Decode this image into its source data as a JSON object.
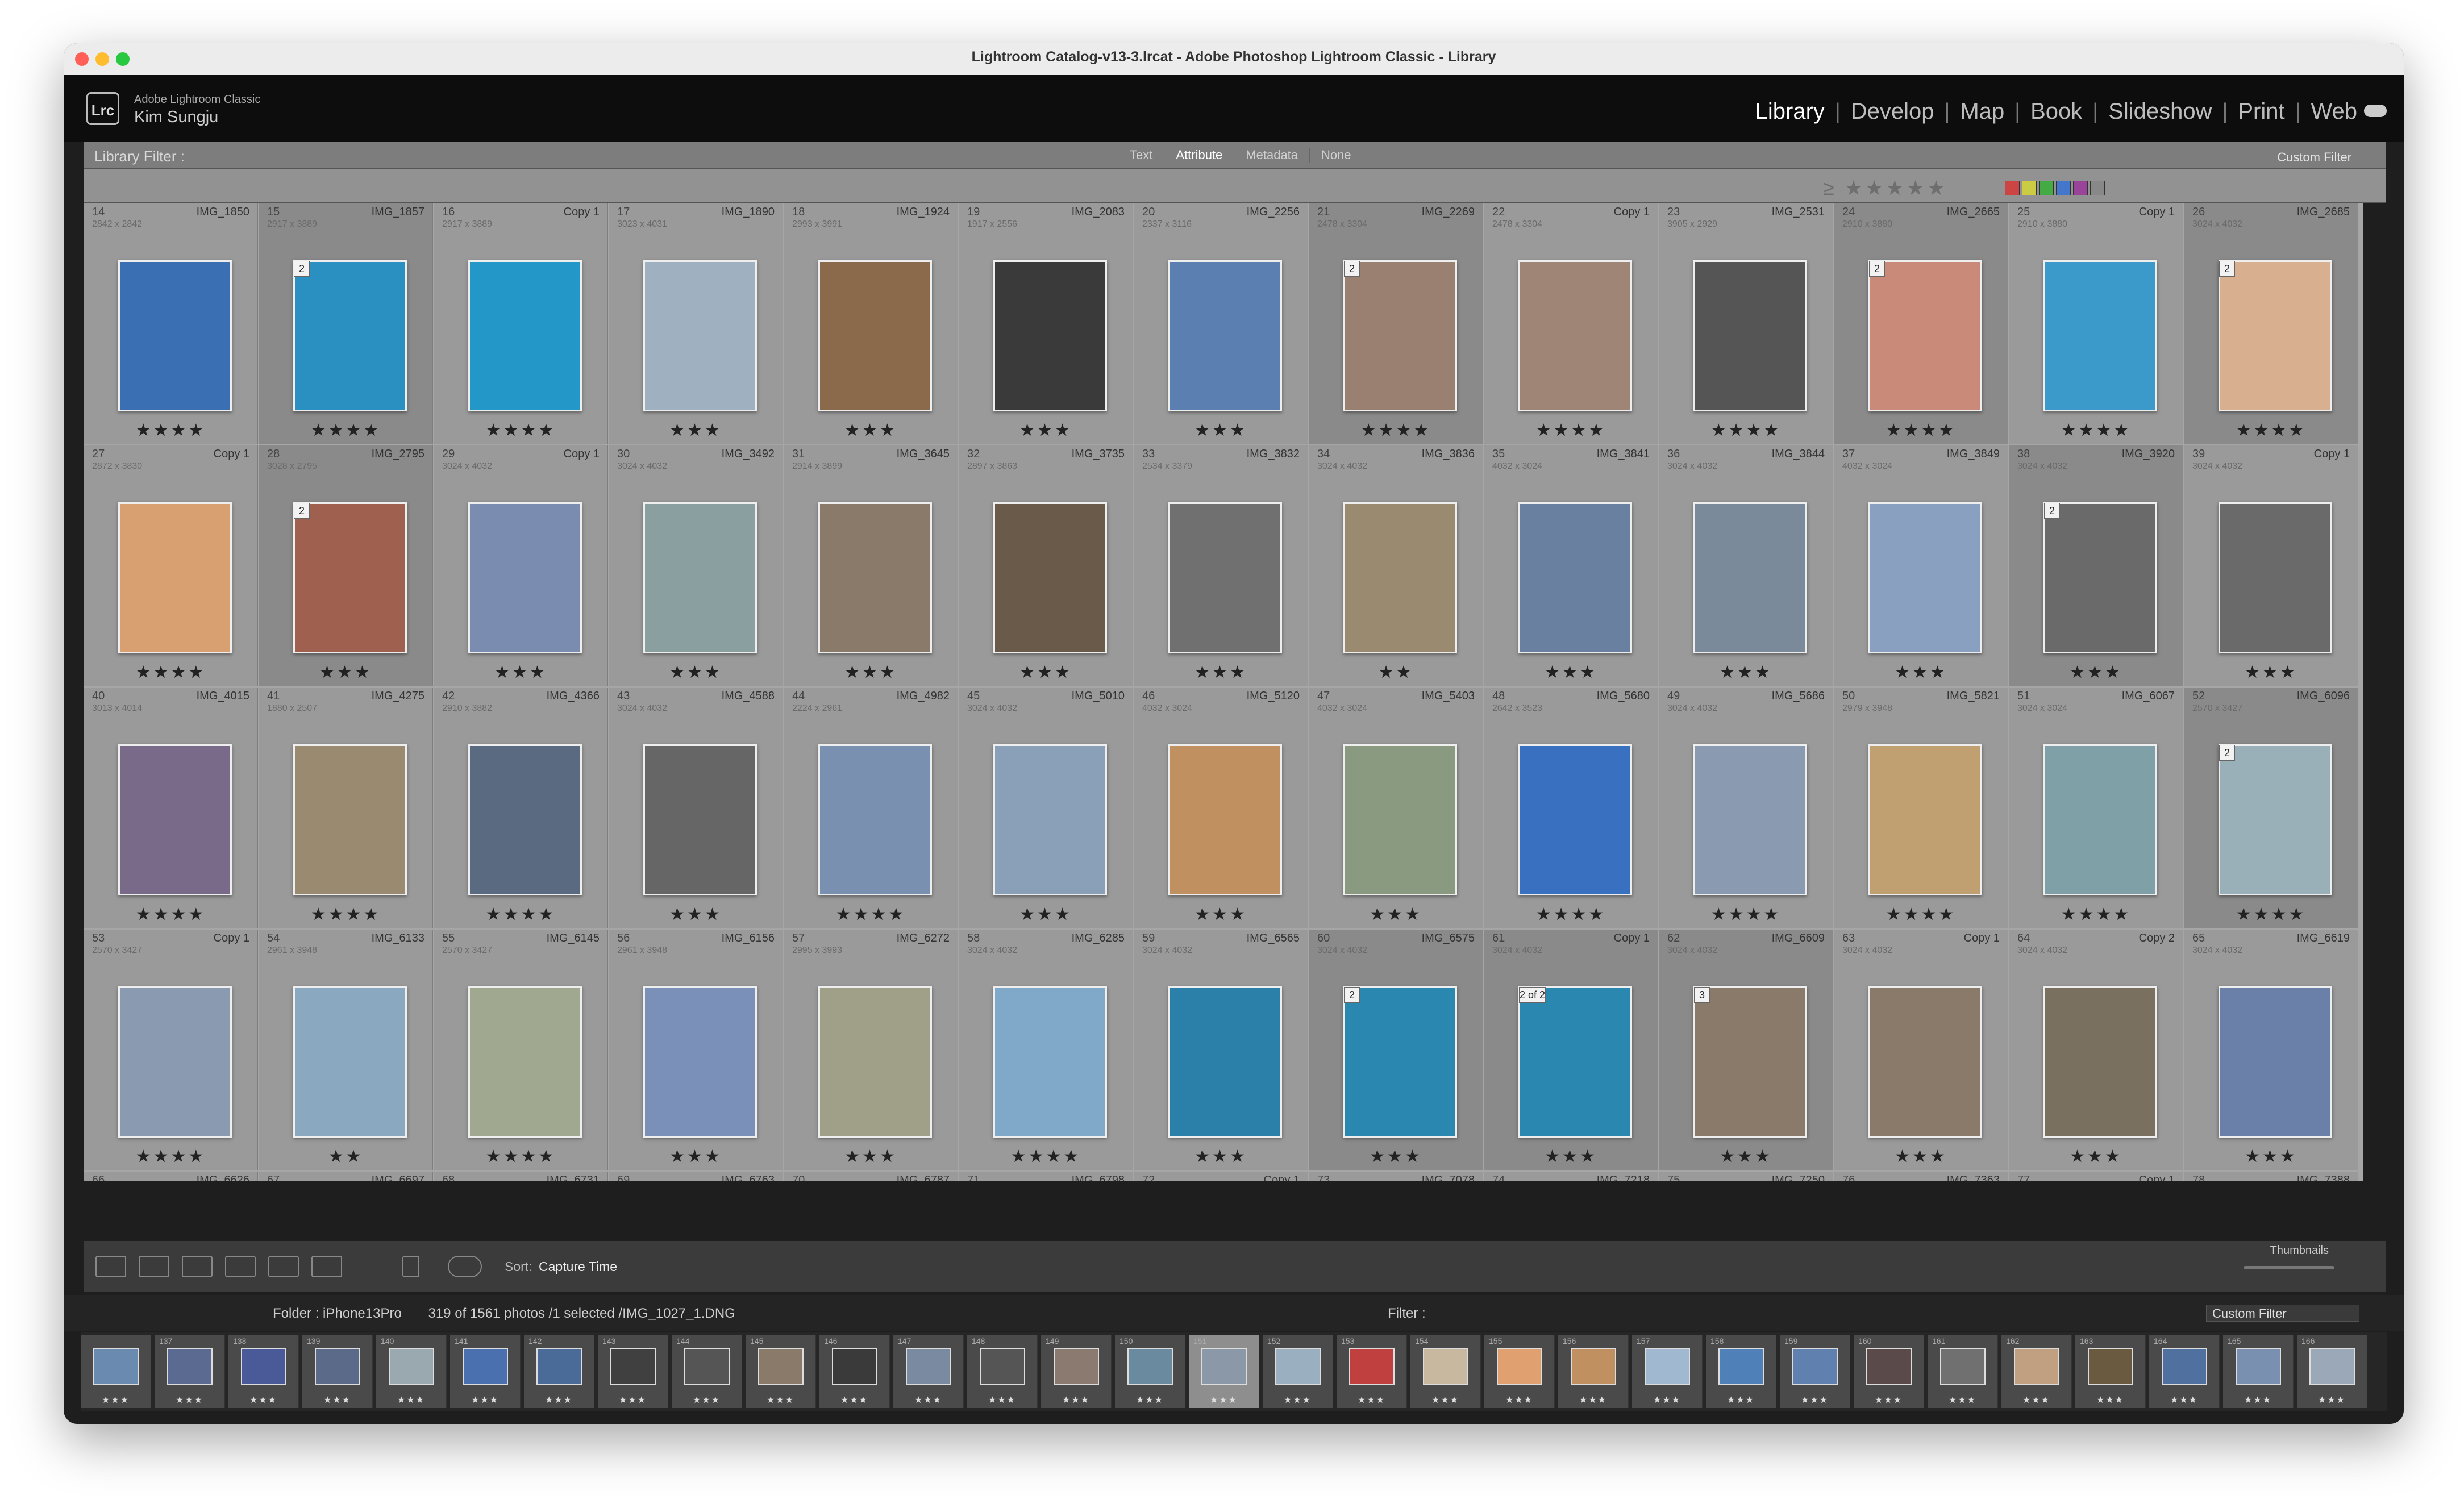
{
  "window": {
    "title": "Lightroom Catalog-v13-3.lrcat - Adobe Photoshop Lightroom Classic - Library"
  },
  "identity": {
    "app": "Adobe Lightroom Classic",
    "user": "Kim Sungju",
    "logo": "Lrc"
  },
  "modules": [
    {
      "label": "Library",
      "active": true
    },
    {
      "label": "Develop"
    },
    {
      "label": "Map"
    },
    {
      "label": "Book"
    },
    {
      "label": "Slideshow"
    },
    {
      "label": "Print"
    },
    {
      "label": "Web"
    }
  ],
  "filter_bar": {
    "title": "Library Filter :",
    "tabs": [
      "Text",
      "Attribute",
      "Metadata",
      "None"
    ],
    "active_tab": "Attribute",
    "preset": "Custom Filter"
  },
  "colors": {
    "label_swatches": [
      "#c44",
      "#cc4",
      "#4a4",
      "#47c",
      "#949",
      "#888"
    ]
  },
  "grid": {
    "rows": [
      {
        "top_stars": "★★★★",
        "cells": [
          {
            "n": "14",
            "f": "IMG_1850",
            "d": "2842 x 2842",
            "c": "#3a6fb4",
            "stars": "★★★★"
          },
          {
            "n": "15",
            "f": "IMG_1857",
            "d": "2917 x 3889",
            "c": "#2a8fc1",
            "badge": "2",
            "stars": "★★★★"
          },
          {
            "n": "16",
            "f": "Copy 1",
            "d": "2917 x 3889",
            "c": "#2398c8",
            "stars": "★★★★"
          },
          {
            "n": "17",
            "f": "IMG_1890",
            "d": "3023 x 4031",
            "c": "#9fb0c0",
            "stars": "★★★"
          },
          {
            "n": "18",
            "f": "IMG_1924",
            "d": "2993 x 3991",
            "c": "#8a6a4a",
            "stars": "★★★"
          },
          {
            "n": "19",
            "f": "IMG_2083",
            "d": "1917 x 2556",
            "c": "#3a3a3a",
            "stars": "★★★"
          },
          {
            "n": "20",
            "f": "IMG_2256",
            "d": "2337 x 3116",
            "c": "#5a7fb0",
            "stars": "★★★"
          },
          {
            "n": "21",
            "f": "IMG_2269",
            "d": "2478 x 3304",
            "c": "#9a8070",
            "badge": "2",
            "stars": "★★★★"
          },
          {
            "n": "22",
            "f": "Copy 1",
            "d": "2478 x 3304",
            "c": "#9e8575",
            "stars": "★★★★"
          },
          {
            "n": "23",
            "f": "IMG_2531",
            "d": "3905 x 2929",
            "c": "#555555",
            "stars": "★★★★"
          },
          {
            "n": "24",
            "f": "IMG_2665",
            "d": "2910 x 3880",
            "c": "#c98a7a",
            "badge": "2",
            "stars": "★★★★"
          },
          {
            "n": "25",
            "f": "Copy 1",
            "d": "2910 x 3880",
            "c": "#3b9ac9",
            "stars": "★★★★"
          },
          {
            "n": "26",
            "f": "IMG_2685",
            "d": "3024 x 4032",
            "c": "#d8b090",
            "badge": "2",
            "stars": "★★★★"
          }
        ]
      },
      {
        "top_stars": "★★★★",
        "cells": [
          {
            "n": "27",
            "f": "Copy 1",
            "d": "2872 x 3830",
            "c": "#d8a070",
            "stars": "★★★★"
          },
          {
            "n": "28",
            "f": "IMG_2795",
            "d": "3028 x 2795",
            "c": "#a06050",
            "badge": "2",
            "stars": "★★★"
          },
          {
            "n": "29",
            "f": "Copy 1",
            "d": "3024 x 4032",
            "c": "#7a8cb0",
            "stars": "★★★"
          },
          {
            "n": "30",
            "f": "IMG_3492",
            "d": "3024 x 4032",
            "c": "#8aa0a0",
            "stars": "★★★"
          },
          {
            "n": "31",
            "f": "IMG_3645",
            "d": "2914 x 3899",
            "c": "#8a7a6a",
            "stars": "★★★"
          },
          {
            "n": "32",
            "f": "IMG_3735",
            "d": "2897 x 3863",
            "c": "#6a5a4a",
            "stars": "★★★"
          },
          {
            "n": "33",
            "f": "IMG_3832",
            "d": "2534 x 3379",
            "c": "#707070",
            "stars": "★★★"
          },
          {
            "n": "34",
            "f": "IMG_3836",
            "d": "3024 x 4032",
            "c": "#9a8a70",
            "stars": "★★"
          },
          {
            "n": "35",
            "f": "IMG_3841",
            "d": "4032 x 3024",
            "c": "#6a80a0",
            "stars": "★★★"
          },
          {
            "n": "36",
            "f": "IMG_3844",
            "d": "3024 x 4032",
            "c": "#7a8a9a",
            "stars": "★★★"
          },
          {
            "n": "37",
            "f": "IMG_3849",
            "d": "4032 x 3024",
            "c": "#8aa0c0",
            "stars": "★★★"
          },
          {
            "n": "38",
            "f": "IMG_3920",
            "d": "3024 x 4032",
            "c": "#6a6a6a",
            "badge": "2",
            "stars": "★★★"
          },
          {
            "n": "39",
            "f": "Copy 1",
            "d": "3024 x 4032",
            "c": "#6a6a6a",
            "stars": "★★★"
          }
        ]
      },
      {
        "top_stars": "★★★★",
        "cells": [
          {
            "n": "40",
            "f": "IMG_4015",
            "d": "3013 x 4014",
            "c": "#7a6a8a",
            "stars": "★★★★"
          },
          {
            "n": "41",
            "f": "IMG_4275",
            "d": "1880 x 2507",
            "c": "#9a8a70",
            "stars": "★★★★"
          },
          {
            "n": "42",
            "f": "IMG_4366",
            "d": "2910 x 3882",
            "c": "#5a6a80",
            "stars": "★★★★"
          },
          {
            "n": "43",
            "f": "IMG_4588",
            "d": "3024 x 4032",
            "c": "#666666",
            "stars": "★★★"
          },
          {
            "n": "44",
            "f": "IMG_4982",
            "d": "2224 x 2961",
            "c": "#7a90b0",
            "stars": "★★★★"
          },
          {
            "n": "45",
            "f": "IMG_5010",
            "d": "3024 x 4032",
            "c": "#8aa0b8",
            "stars": "★★★"
          },
          {
            "n": "46",
            "f": "IMG_5120",
            "d": "4032 x 3024",
            "c": "#c09060",
            "stars": "★★★"
          },
          {
            "n": "47",
            "f": "IMG_5403",
            "d": "4032 x 3024",
            "c": "#8a9a80",
            "stars": "★★★"
          },
          {
            "n": "48",
            "f": "IMG_5680",
            "d": "2642 x 3523",
            "c": "#3a70c0",
            "stars": "★★★★"
          },
          {
            "n": "49",
            "f": "IMG_5686",
            "d": "3024 x 4032",
            "c": "#8a9ab0",
            "stars": "★★★★"
          },
          {
            "n": "50",
            "f": "IMG_5821",
            "d": "2979 x 3948",
            "c": "#c0a070",
            "stars": "★★★★"
          },
          {
            "n": "51",
            "f": "IMG_6067",
            "d": "3024 x 3024",
            "c": "#80a0a8",
            "stars": "★★★★"
          },
          {
            "n": "52",
            "f": "IMG_6096",
            "d": "2570 x 3427",
            "c": "#9ab0b8",
            "badge": "2",
            "stars": "★★★★"
          }
        ]
      },
      {
        "top_stars": "★★★★",
        "cells": [
          {
            "n": "53",
            "f": "Copy 1",
            "d": "2570 x 3427",
            "c": "#8a9ab0",
            "stars": "★★★★"
          },
          {
            "n": "54",
            "f": "IMG_6133",
            "d": "2961 x 3948",
            "c": "#8aa8c0",
            "stars": "★★"
          },
          {
            "n": "55",
            "f": "IMG_6145",
            "d": "2570 x 3427",
            "c": "#a0a890",
            "stars": "★★★★"
          },
          {
            "n": "56",
            "f": "IMG_6156",
            "d": "2961 x 3948",
            "c": "#7a90b8",
            "stars": "★★★"
          },
          {
            "n": "57",
            "f": "IMG_6272",
            "d": "2995 x 3993",
            "c": "#a0a088",
            "stars": "★★★"
          },
          {
            "n": "58",
            "f": "IMG_6285",
            "d": "3024 x 4032",
            "c": "#80a8c8",
            "stars": "★★★★"
          },
          {
            "n": "59",
            "f": "IMG_6565",
            "d": "3024 x 4032",
            "c": "#2a80a8",
            "stars": "★★★"
          },
          {
            "n": "60",
            "f": "IMG_6575",
            "d": "3024 x 4032",
            "c": "#2a88b0",
            "badge": "2",
            "stars": "★★★"
          },
          {
            "n": "61",
            "f": "Copy 1",
            "d": "3024 x 4032",
            "c": "#2a88b0",
            "badge": "2 of 2",
            "stars": "★★★"
          },
          {
            "n": "62",
            "f": "IMG_6609",
            "d": "3024 x 4032",
            "c": "#8a7a6a",
            "badge": "3",
            "stars": "★★★"
          },
          {
            "n": "63",
            "f": "Copy 1",
            "d": "3024 x 4032",
            "c": "#8a7a6a",
            "stars": "★★★"
          },
          {
            "n": "64",
            "f": "Copy 2",
            "d": "3024 x 4032",
            "c": "#7a7060",
            "stars": "★★★"
          },
          {
            "n": "65",
            "f": "IMG_6619",
            "d": "3024 x 4032",
            "c": "#6a80a8",
            "stars": "★★★"
          }
        ]
      }
    ],
    "bottom_row": [
      {
        "n": "66",
        "f": "IMG_6626"
      },
      {
        "n": "67",
        "f": "IMG_6697"
      },
      {
        "n": "68",
        "f": "IMG_6731"
      },
      {
        "n": "69",
        "f": "IMG_6763"
      },
      {
        "n": "70",
        "f": "IMG_6787"
      },
      {
        "n": "71",
        "f": "IMG_6798"
      },
      {
        "n": "72",
        "f": "Copy 1"
      },
      {
        "n": "73",
        "f": "IMG_7078"
      },
      {
        "n": "74",
        "f": "IMG_7218"
      },
      {
        "n": "75",
        "f": "IMG_7250"
      },
      {
        "n": "76",
        "f": "IMG_7363"
      },
      {
        "n": "77",
        "f": "Copy 1"
      },
      {
        "n": "78",
        "f": "IMG_7388"
      }
    ]
  },
  "toolbar": {
    "sort_label": "Sort:",
    "sort_value": "Capture Time",
    "thumbnails_label": "Thumbnails",
    "thumbnail_size": 0.5
  },
  "filmstrip_header": {
    "folder": "Folder : iPhone13Pro",
    "count": "319 of 1561 photos /1 selected /IMG_1027_1.DNG",
    "filter_label": "Filter :",
    "preset": "Custom Filter"
  },
  "filmstrip": [
    {
      "n": "",
      "c": "#6a8ab0"
    },
    {
      "n": "137",
      "c": "#5a6a90"
    },
    {
      "n": "138",
      "c": "#4a5a98"
    },
    {
      "n": "139",
      "c": "#5a6a88"
    },
    {
      "n": "140",
      "c": "#9aa8b0"
    },
    {
      "n": "141",
      "c": "#4a70b0"
    },
    {
      "n": "142",
      "c": "#4a6a98"
    },
    {
      "n": "143",
      "c": "#404040"
    },
    {
      "n": "144",
      "c": "#555555"
    },
    {
      "n": "145",
      "c": "#8a7a6a"
    },
    {
      "n": "146",
      "c": "#3a3a3a"
    },
    {
      "n": "147",
      "c": "#7a8aa0"
    },
    {
      "n": "148",
      "c": "#555555"
    },
    {
      "n": "149",
      "c": "#8a7a70"
    },
    {
      "n": "150",
      "c": "#6a8aa0"
    },
    {
      "n": "151",
      "c": "#8a98a8",
      "sel": true
    },
    {
      "n": "152",
      "c": "#9ab0c0"
    },
    {
      "n": "153",
      "c": "#c04040"
    },
    {
      "n": "154",
      "c": "#c8b8a0"
    },
    {
      "n": "155",
      "c": "#e0a070"
    },
    {
      "n": "156",
      "c": "#c09060"
    },
    {
      "n": "157",
      "c": "#a0b8d0"
    },
    {
      "n": "158",
      "c": "#5080b8"
    },
    {
      "n": "159",
      "c": "#6080b0"
    },
    {
      "n": "160",
      "c": "#5a4a4a"
    },
    {
      "n": "161",
      "c": "#707070"
    },
    {
      "n": "162",
      "c": "#c0a080"
    },
    {
      "n": "163",
      "c": "#6a5a40"
    },
    {
      "n": "164",
      "c": "#5070a0"
    },
    {
      "n": "165",
      "c": "#7a90b0"
    },
    {
      "n": "166",
      "c": "#9aa8b8"
    }
  ]
}
